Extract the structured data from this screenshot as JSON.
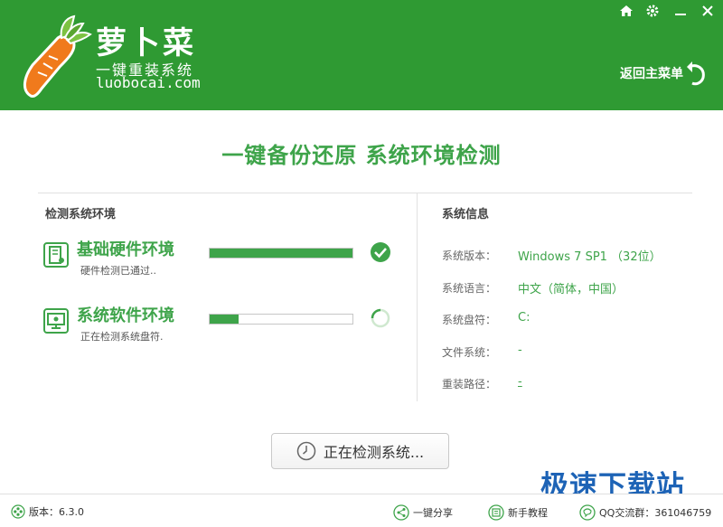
{
  "app": {
    "name": "萝卜菜",
    "slogan": "一键重装系统",
    "url": "luobocai.com",
    "back_menu_label": "返回主菜单"
  },
  "window_controls": [
    "home-icon",
    "gear-icon",
    "minimize-icon",
    "close-icon"
  ],
  "page": {
    "title": "一键备份还原  系统环境检测"
  },
  "check_panel": {
    "title": "检测系统环境",
    "items": [
      {
        "name": "基础硬件环境",
        "status": "硬件检测已通过..",
        "progress_percent": 100,
        "state": "done"
      },
      {
        "name": "系统软件环境",
        "status": "正在检测系统盘符.",
        "progress_percent": 20,
        "state": "loading"
      }
    ]
  },
  "info_panel": {
    "title": "系统信息",
    "rows": [
      {
        "label": "系统版本：",
        "value": "Windows 7 SP1 （32位）"
      },
      {
        "label": "系统语言：",
        "value": "中文（简体，中国）"
      },
      {
        "label": "系统盘符：",
        "value": "C:"
      },
      {
        "label": "文件系统：",
        "value": "-"
      },
      {
        "label": "重装路径：",
        "value": "-"
      }
    ]
  },
  "main_button": {
    "label": "正在检测系统..."
  },
  "footer": {
    "version": "版本：6.3.0",
    "share": "一键分享",
    "tutorial": "新手教程",
    "qq_group": "QQ交流群：361046759"
  },
  "watermark": "极速下载站",
  "colors": {
    "brand_green": "#2f9a33",
    "accent_green": "#3ea44a",
    "watermark_blue": "#1d63b6"
  }
}
